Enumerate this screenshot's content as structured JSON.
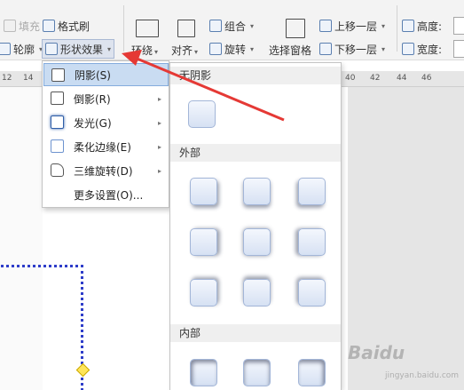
{
  "ribbon": {
    "fill_label": "填充",
    "format_brush_label": "格式刷",
    "outline_label": "轮廓",
    "shape_effects_label": "形状效果",
    "wrap_label": "环绕",
    "align_label": "对齐",
    "group_label": "组合",
    "rotate_label": "旋转",
    "selection_pane_label": "选择窗格",
    "bring_forward_label": "上移一层",
    "send_backward_label": "下移一层",
    "height_label": "高度:",
    "width_label": "宽度:"
  },
  "ruler": {
    "ticks": [
      "12",
      "14",
      "40",
      "42",
      "44",
      "46"
    ]
  },
  "menu": {
    "items": [
      {
        "label": "阴影(S)",
        "icon": "shadow-icon",
        "has_submenu": false,
        "highlighted": true
      },
      {
        "label": "倒影(R)",
        "icon": "reflection-icon",
        "has_submenu": true
      },
      {
        "label": "发光(G)",
        "icon": "glow-icon",
        "has_submenu": true
      },
      {
        "label": "柔化边缘(E)",
        "icon": "soft-edge-icon",
        "has_submenu": true
      },
      {
        "label": "三维旋转(D)",
        "icon": "3d-rotation-icon",
        "has_submenu": true
      },
      {
        "label": "更多设置(O)...",
        "icon": "",
        "has_submenu": false
      }
    ]
  },
  "submenu": {
    "no_shadow_header": "无阴影",
    "outer_header": "外部",
    "inner_header": "内部"
  },
  "watermark": {
    "text": "Baidu",
    "sub": "jingyan.baidu.com"
  },
  "colors": {
    "highlight": "#c9dcf2",
    "selection_outline": "#2e3dc9",
    "arrow": "#e53935"
  }
}
